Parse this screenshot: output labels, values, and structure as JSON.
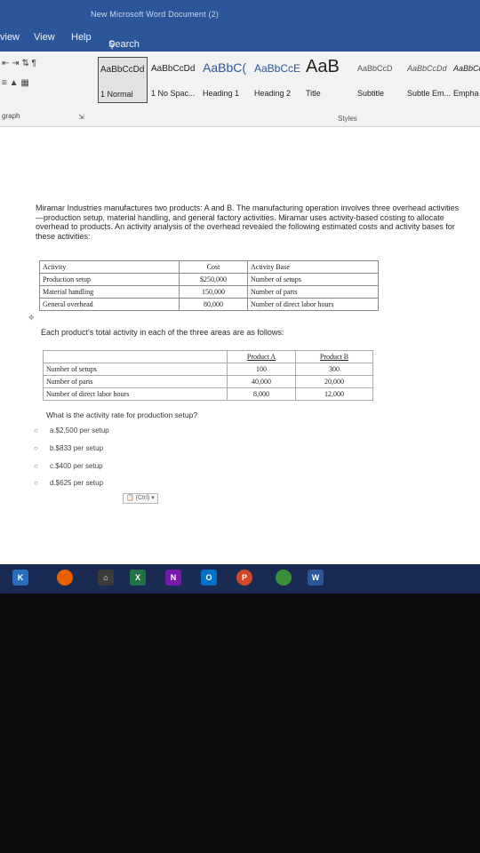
{
  "window": {
    "title": "New Microsoft Word Document (2)"
  },
  "menu": {
    "items": [
      "view",
      "View",
      "Help"
    ],
    "search_label": "Search"
  },
  "ribbon": {
    "styles": [
      {
        "sample": "AaBbCcDd",
        "name": "1 Normal"
      },
      {
        "sample": "AaBbCcDd",
        "name": "1 No Spac..."
      },
      {
        "sample": "AaBbC(",
        "name": "Heading 1"
      },
      {
        "sample": "AaBbCcE",
        "name": "Heading 2"
      },
      {
        "sample": "AaB",
        "name": "Title"
      },
      {
        "sample": "AaBbCcD",
        "name": "Subtitle"
      },
      {
        "sample": "AaBbCcDd",
        "name": "Subtle Em..."
      },
      {
        "sample": "AaBbCc",
        "name": "Empha"
      }
    ],
    "styles_group_label": "Styles",
    "paragraph_group_label": "graph"
  },
  "document": {
    "intro": "Miramar Industries manufactures two products: A and B. The manufacturing operation involves three overhead activities—production setup, material handling, and general factory activities. Miramar uses activity-based costing to allocate overhead to products. An activity analysis of the overhead revealed the following estimated costs and activity bases for these activities:",
    "table1": {
      "headers": [
        "Activity",
        "Cost",
        "Activity Base"
      ],
      "rows": [
        [
          "Production setup",
          "$250,000",
          "Number of setups"
        ],
        [
          "Material handling",
          "150,000",
          "Number of parts"
        ],
        [
          "General overhead",
          "80,000",
          "Number of direct labor hours"
        ]
      ]
    },
    "midline": "Each product's total activity in each of the three areas are as follows:",
    "table2": {
      "headers": [
        "",
        "Product A",
        "Product B"
      ],
      "rows": [
        [
          "Number of setups",
          "100",
          "300"
        ],
        [
          "Number of parts",
          "40,000",
          "20,000"
        ],
        [
          "Number of direct labor hours",
          "8,000",
          "12,000"
        ]
      ]
    },
    "question": "What is the activity rate for production setup?",
    "choices": [
      "a.$2,500 per setup",
      "b.$833 per setup",
      "c.$400 per setup",
      "d.$625 per setup"
    ],
    "paste_options_label": "(Ctrl) ▾"
  },
  "taskbar": {
    "icons": [
      {
        "name": "kodi-icon",
        "label": "K",
        "color": "#2a6ebb"
      },
      {
        "name": "firefox-icon",
        "label": "",
        "color": "#e66000"
      },
      {
        "name": "home-icon",
        "label": "",
        "color": "#3b3b3b"
      },
      {
        "name": "excel-icon",
        "label": "X",
        "color": "#217346"
      },
      {
        "name": "onenote-icon",
        "label": "N",
        "color": "#7719aa"
      },
      {
        "name": "outlook-icon",
        "label": "O",
        "color": "#0072c6"
      },
      {
        "name": "powerpoint-icon",
        "label": "P",
        "color": "#d24726"
      },
      {
        "name": "chrome-icon",
        "label": "",
        "color": "#3a8f3a"
      },
      {
        "name": "word-icon",
        "label": "W",
        "color": "#2b579a"
      }
    ]
  }
}
